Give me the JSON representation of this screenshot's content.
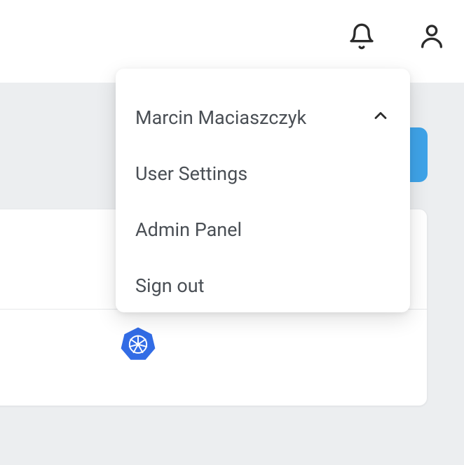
{
  "header": {
    "icons": {
      "notifications": "bell-icon",
      "account": "user-icon"
    }
  },
  "dropdown": {
    "user_name": "Marcin Maciaszczyk",
    "items": [
      {
        "label": "User Settings"
      },
      {
        "label": "Admin Panel"
      },
      {
        "label": "Sign out"
      }
    ]
  },
  "card": {
    "icon": "kubernetes-icon"
  },
  "colors": {
    "primary_button": "#3fa3e8",
    "panel_bg": "#ffffff",
    "page_bg": "#eceef0",
    "text": "#4a4f55",
    "k8s_blue": "#326ce5"
  }
}
